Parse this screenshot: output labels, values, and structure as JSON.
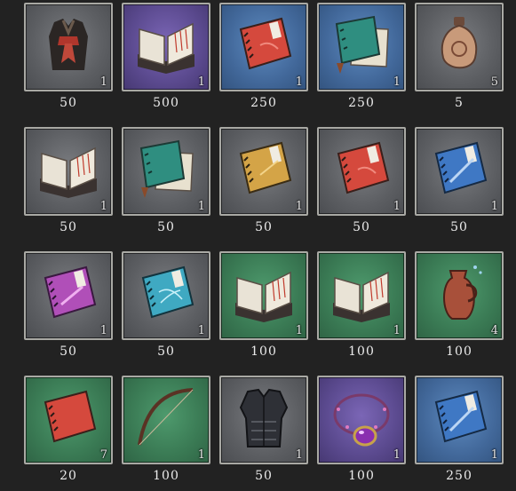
{
  "shop": {
    "items": [
      {
        "icon": "cloth-robe-icon",
        "bg": "grey",
        "count": "1",
        "price": "50"
      },
      {
        "icon": "open-book-icon",
        "bg": "purple",
        "count": "1",
        "price": "500"
      },
      {
        "icon": "red-manual-icon",
        "bg": "blue",
        "count": "1",
        "price": "250"
      },
      {
        "icon": "green-manual-icon",
        "bg": "blue",
        "count": "1",
        "price": "250"
      },
      {
        "icon": "gourd-bottle-icon",
        "bg": "grey",
        "count": "5",
        "price": "5"
      },
      {
        "icon": "open-book-icon",
        "bg": "grey",
        "count": "1",
        "price": "50"
      },
      {
        "icon": "green-manual-icon",
        "bg": "grey",
        "count": "1",
        "price": "50"
      },
      {
        "icon": "yellow-manual-icon",
        "bg": "grey",
        "count": "1",
        "price": "50"
      },
      {
        "icon": "red-manual-icon",
        "bg": "grey",
        "count": "1",
        "price": "50"
      },
      {
        "icon": "blue-manual-icon",
        "bg": "grey",
        "count": "1",
        "price": "50"
      },
      {
        "icon": "purple-manual-icon",
        "bg": "grey",
        "count": "1",
        "price": "50"
      },
      {
        "icon": "cyan-manual-icon",
        "bg": "grey",
        "count": "1",
        "price": "50"
      },
      {
        "icon": "open-book-icon",
        "bg": "green",
        "count": "1",
        "price": "100"
      },
      {
        "icon": "open-book-icon",
        "bg": "green",
        "count": "1",
        "price": "100"
      },
      {
        "icon": "clay-jug-icon",
        "bg": "green",
        "count": "4",
        "price": "100"
      },
      {
        "icon": "red-manual-icon",
        "bg": "green",
        "count": "7",
        "price": "20"
      },
      {
        "icon": "bow-icon",
        "bg": "green",
        "count": "1",
        "price": "100"
      },
      {
        "icon": "armor-vest-icon",
        "bg": "grey",
        "count": "1",
        "price": "50"
      },
      {
        "icon": "amulet-necklace-icon",
        "bg": "purple",
        "count": "1",
        "price": "100"
      },
      {
        "icon": "blue-manual-icon",
        "bg": "blue",
        "count": "1",
        "price": "250"
      }
    ]
  }
}
